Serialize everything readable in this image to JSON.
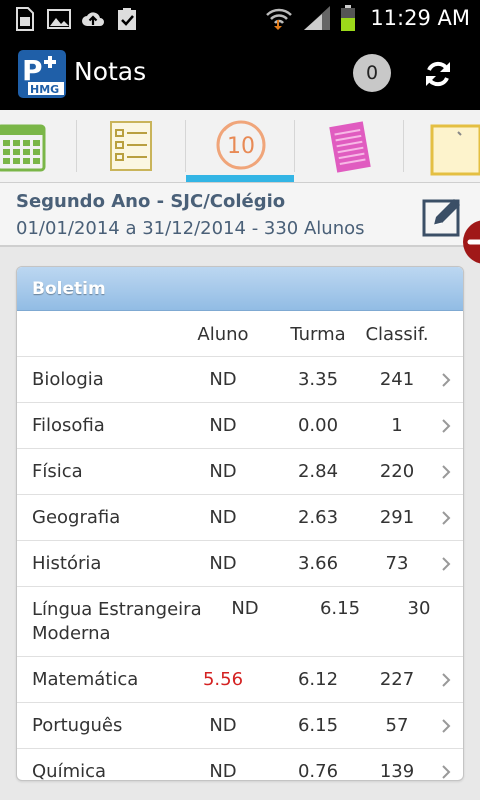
{
  "status": {
    "time": "11:29 AM"
  },
  "app": {
    "title": "Notas",
    "logo_text": "HMG",
    "badge_count": "0"
  },
  "tabs": [
    {
      "name": "calendar",
      "icon": "calendar-icon"
    },
    {
      "name": "checklist",
      "icon": "checklist-icon"
    },
    {
      "name": "grades",
      "icon": "grade-10-icon",
      "label": "10",
      "selected": true
    },
    {
      "name": "notebook",
      "icon": "notebook-icon"
    },
    {
      "name": "note",
      "icon": "sticky-note-icon"
    }
  ],
  "header": {
    "title": "Segundo Ano - SJC/Colégio",
    "subtitle": "01/01/2014 a 31/12/2014 - 330 Alunos"
  },
  "boletim": {
    "title": "Boletim",
    "columns": {
      "aluno": "Aluno",
      "turma": "Turma",
      "classif": "Classif."
    },
    "rows": [
      {
        "subject": "Biologia",
        "aluno": "ND",
        "turma": "3.35",
        "classif": "241"
      },
      {
        "subject": "Filosofia",
        "aluno": "ND",
        "turma": "0.00",
        "classif": "1"
      },
      {
        "subject": "Física",
        "aluno": "ND",
        "turma": "2.84",
        "classif": "220"
      },
      {
        "subject": "Geografia",
        "aluno": "ND",
        "turma": "2.63",
        "classif": "291"
      },
      {
        "subject": "História",
        "aluno": "ND",
        "turma": "3.66",
        "classif": "73"
      },
      {
        "subject": "Língua Estrangeira Moderna",
        "aluno": "ND",
        "turma": "6.15",
        "classif": "30"
      },
      {
        "subject": "Matemática",
        "aluno": "5.56",
        "turma": "6.12",
        "classif": "227"
      },
      {
        "subject": "Português",
        "aluno": "ND",
        "turma": "6.15",
        "classif": "57"
      },
      {
        "subject": "Química",
        "aluno": "ND",
        "turma": "0.76",
        "classif": "139"
      }
    ]
  },
  "colors": {
    "accent": "#33b5e5",
    "header_text": "#4a6078",
    "low_grade": "#d42222",
    "card_head": "#92bce4"
  }
}
